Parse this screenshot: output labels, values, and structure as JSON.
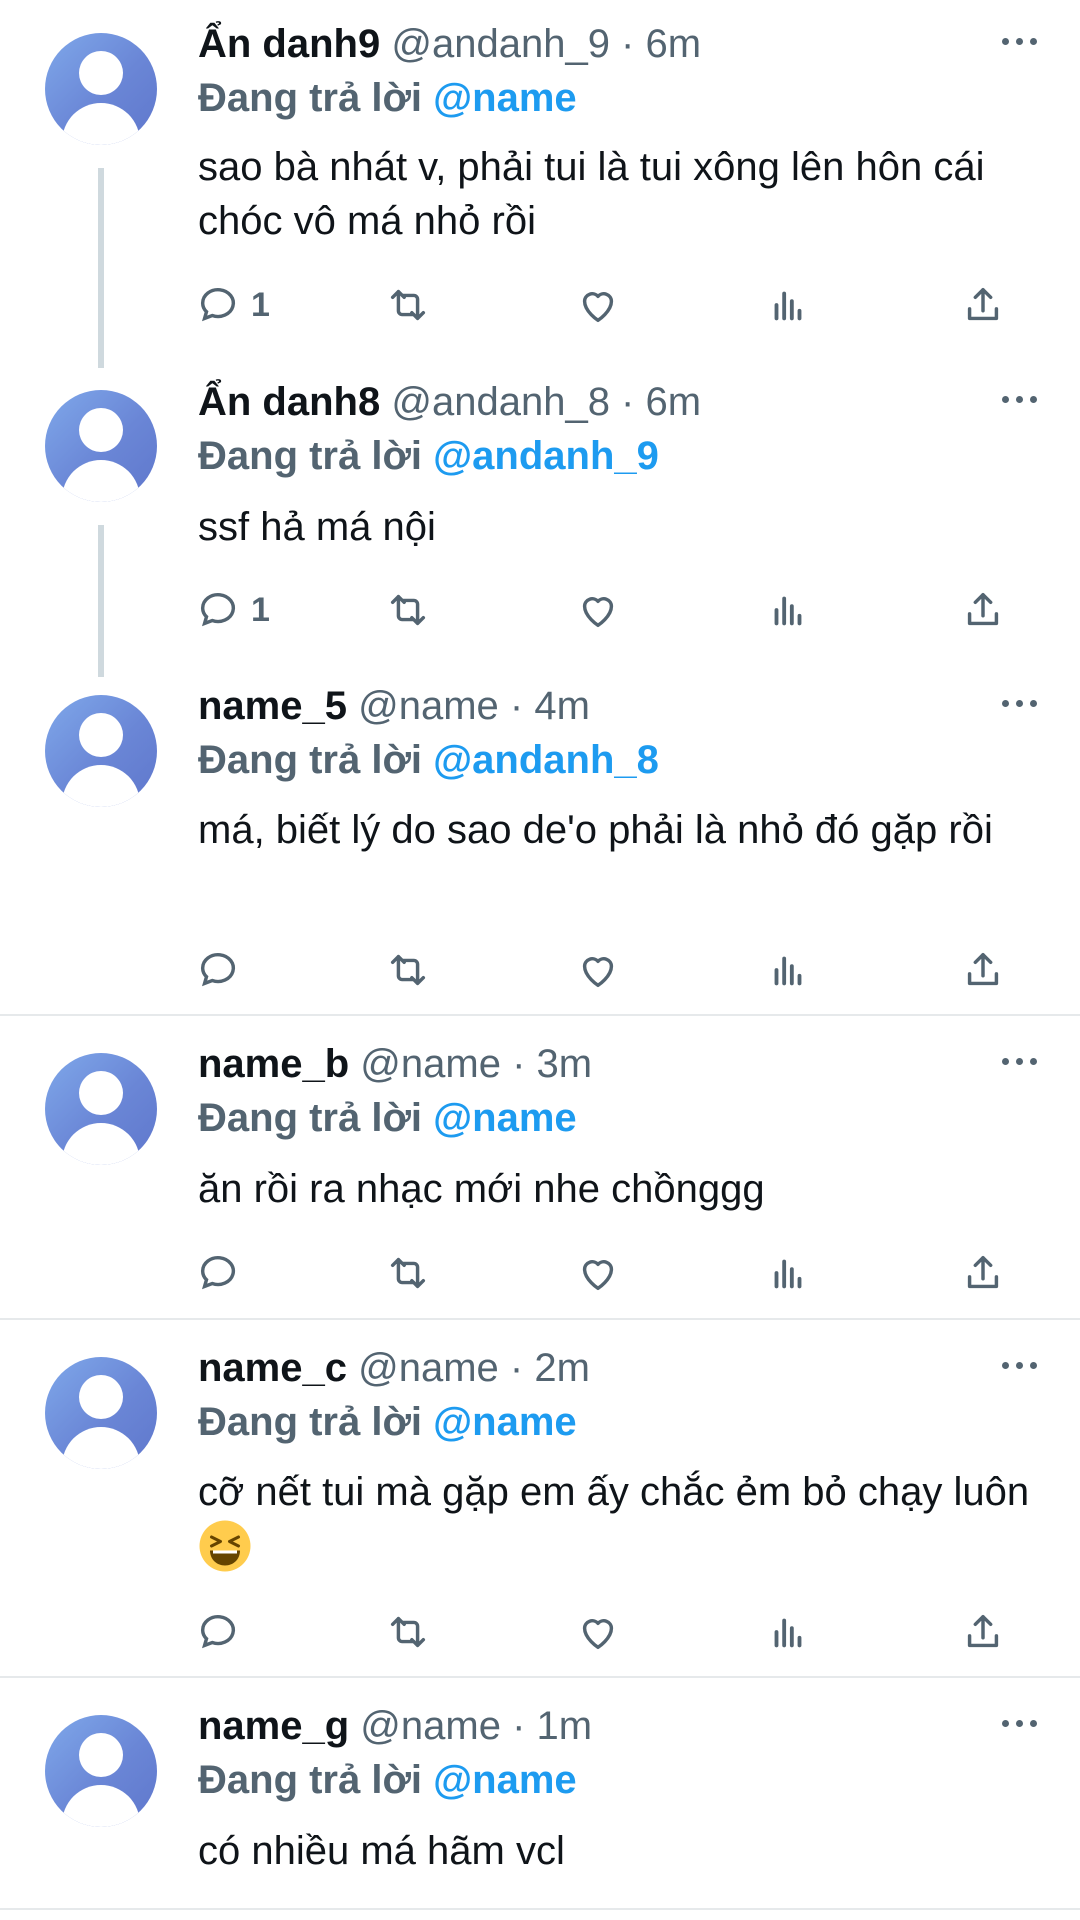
{
  "tweets": [
    {
      "name": "Ẩn danh9",
      "handle": "@andanh_9 · 6m",
      "reply_label": "Đang trả lời",
      "reply_to": "@name",
      "text": "sao bà nhát v, phải tui là tui xông lên hôn cái chóc vô má nhỏ rồi",
      "reply_count": "1"
    },
    {
      "name": "Ẩn danh8",
      "handle": "@andanh_8 · 6m",
      "reply_label": "Đang trả lời",
      "reply_to": "@andanh_9",
      "text": "ssf hả má nội",
      "reply_count": "1"
    },
    {
      "name": "name_5",
      "handle": "@name · 4m",
      "reply_label": "Đang trả lời",
      "reply_to": "@andanh_8",
      "text": "má, biết lý do sao de'o phải là nhỏ đó gặp rồi",
      "reply_count": ""
    },
    {
      "name": "name_b",
      "handle": "@name · 3m",
      "reply_label": "Đang trả lời",
      "reply_to": "@name",
      "text": "ăn rồi ra nhạc mới nhe chồnggg",
      "reply_count": ""
    },
    {
      "name": "name_c",
      "handle": "@name · 2m",
      "reply_label": "Đang trả lời",
      "reply_to": "@name",
      "text": "cỡ nết tui mà gặp em ấy chắc ẻm bỏ chạy luôn",
      "reply_count": ""
    },
    {
      "name": "name_g",
      "handle": "@name · 1m",
      "reply_label": "Đang trả lời",
      "reply_to": "@name",
      "text": "có nhiều má hãm vcl",
      "reply_count": ""
    }
  ],
  "icons": {
    "reply": "reply-icon",
    "retweet": "retweet-icon",
    "like": "like-icon",
    "views": "views-icon",
    "share": "share-icon",
    "more": "more-icon",
    "avatar": "default-avatar-icon",
    "emoji": "grinning-squinting-face-emoji"
  },
  "colors": {
    "accent": "#1d9bf0",
    "secondary_text": "#536471",
    "primary_text": "#0f1419",
    "thread_line": "#cfd9de",
    "divider": "#e6e9eb"
  }
}
